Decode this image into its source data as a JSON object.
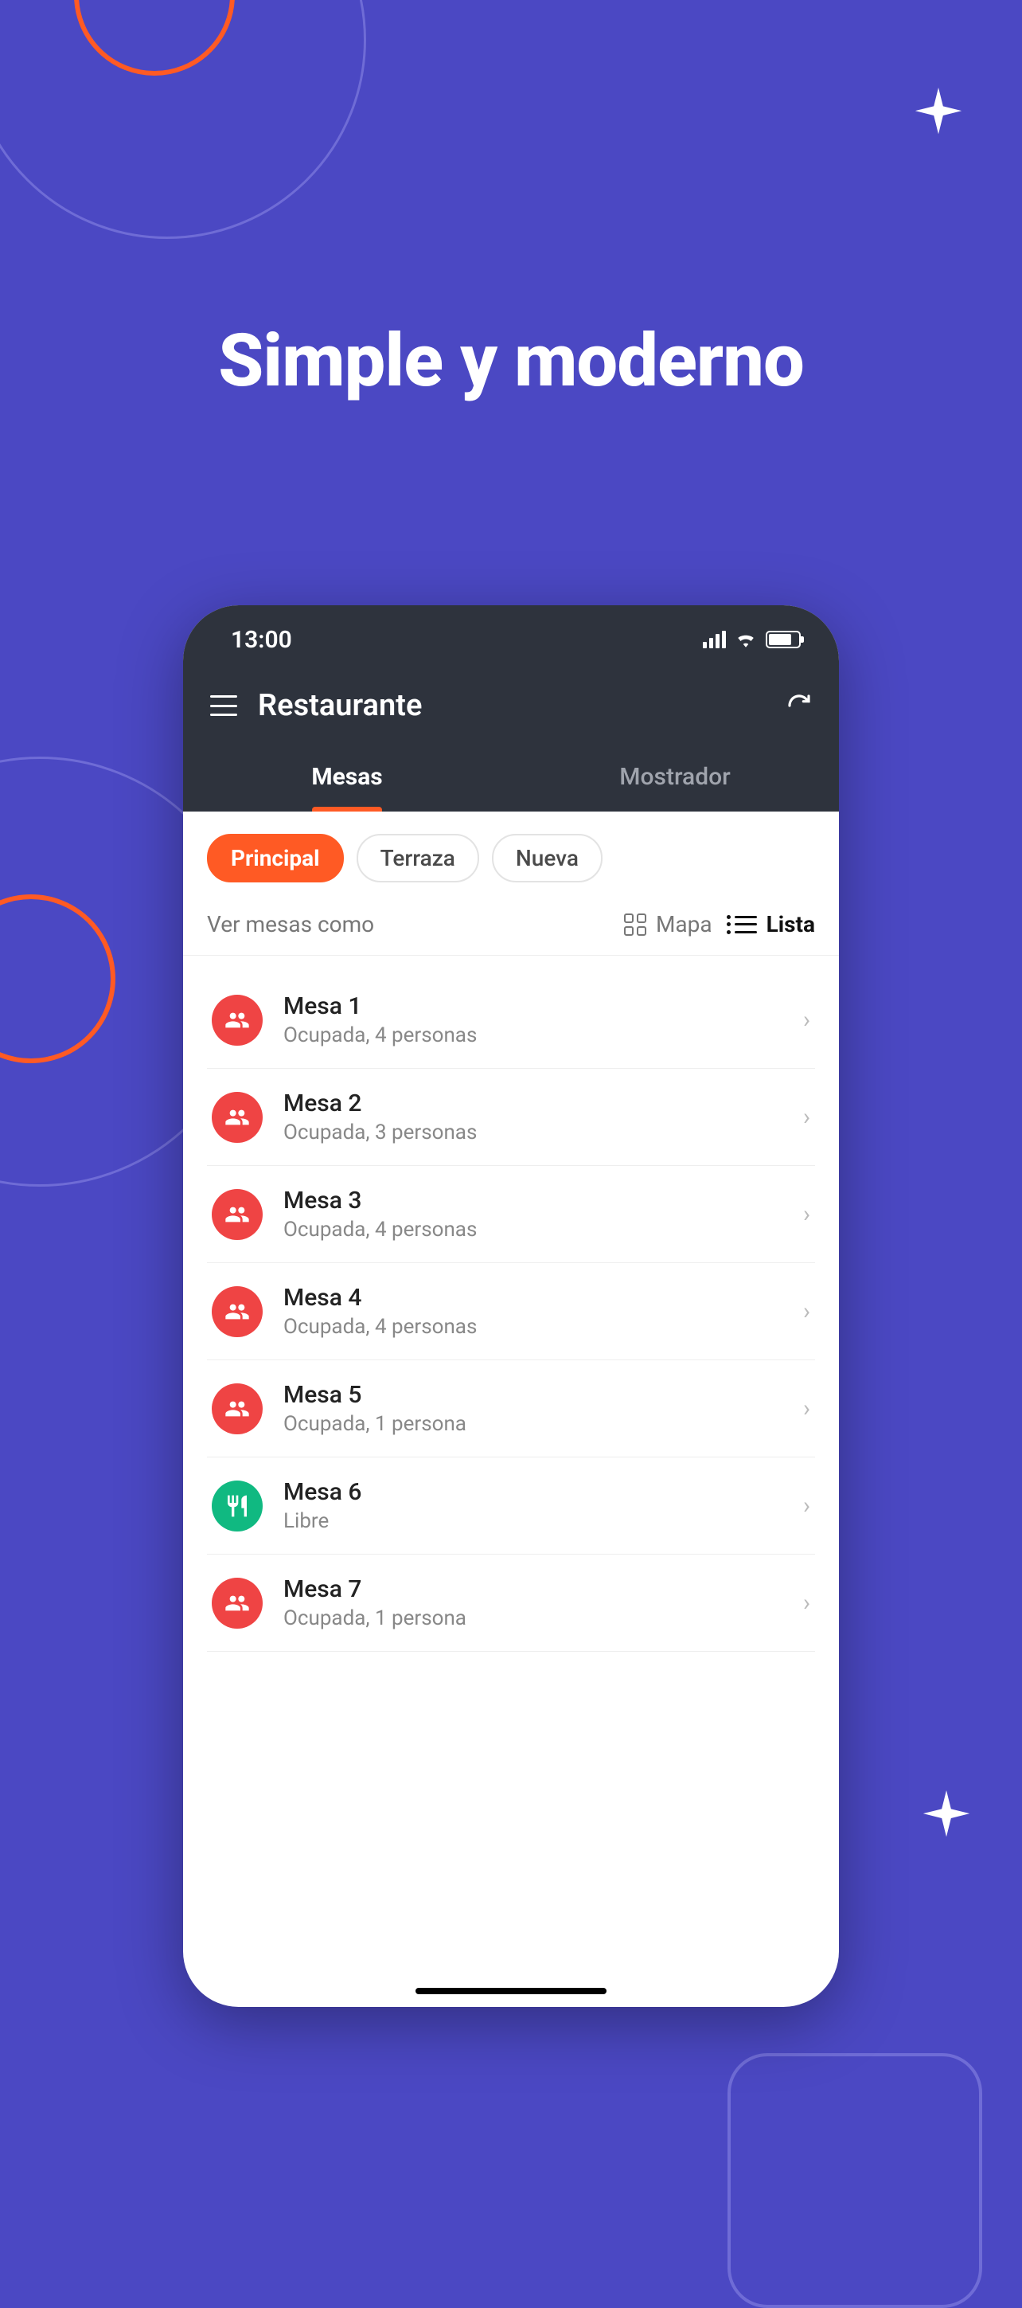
{
  "headline": "Simple y moderno",
  "status": {
    "time": "13:00"
  },
  "header": {
    "title": "Restaurante"
  },
  "tabs": [
    {
      "label": "Mesas",
      "active": true
    },
    {
      "label": "Mostrador",
      "active": false
    }
  ],
  "chips": [
    {
      "label": "Principal",
      "active": true
    },
    {
      "label": "Terraza",
      "active": false
    },
    {
      "label": "Nueva",
      "active": false
    }
  ],
  "view": {
    "label": "Ver mesas como",
    "options": [
      {
        "label": "Mapa",
        "active": false,
        "icon": "grid"
      },
      {
        "label": "Lista",
        "active": true,
        "icon": "list"
      }
    ]
  },
  "tables": [
    {
      "name": "Mesa 1",
      "status": "Ocupada, 4 personas",
      "state": "occupied"
    },
    {
      "name": "Mesa 2",
      "status": "Ocupada, 3 personas",
      "state": "occupied"
    },
    {
      "name": "Mesa 3",
      "status": "Ocupada, 4 personas",
      "state": "occupied"
    },
    {
      "name": "Mesa 4",
      "status": "Ocupada, 4 personas",
      "state": "occupied"
    },
    {
      "name": "Mesa 5",
      "status": "Ocupada, 1 persona",
      "state": "occupied"
    },
    {
      "name": "Mesa 6",
      "status": "Libre",
      "state": "free"
    },
    {
      "name": "Mesa 7",
      "status": "Ocupada, 1 persona",
      "state": "occupied"
    }
  ]
}
